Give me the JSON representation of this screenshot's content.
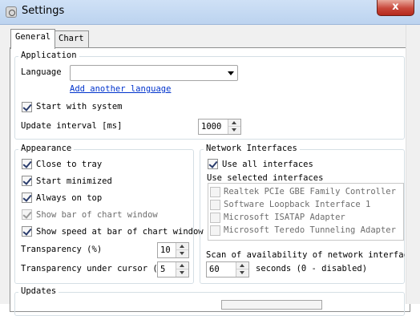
{
  "window": {
    "title": "Settings",
    "close_glyph": "x"
  },
  "tabs": [
    {
      "label": "General"
    },
    {
      "label": "Chart"
    }
  ],
  "application": {
    "title": "Application",
    "language_label": "Language",
    "language_value": "",
    "add_language_link": "Add another language",
    "start_with_system": {
      "label": "Start with system",
      "checked": true
    },
    "update_interval_label": "Update interval [ms]",
    "update_interval_value": "1000"
  },
  "appearance": {
    "title": "Appearance",
    "close_to_tray": "Close to tray",
    "start_minimized": "Start minimized",
    "always_on_top": "Always on top",
    "show_bar_chart_window": "Show bar of chart window",
    "show_speed_bar": "Show speed at bar of chart window",
    "transparency_label": "Transparency (%)",
    "transparency_value": "10",
    "transparency_cursor_label": "Transparency under cursor (%)",
    "transparency_cursor_value": "5"
  },
  "network": {
    "title": "Network Interfaces",
    "use_all_label": "Use all interfaces",
    "use_selected_label": "Use selected interfaces",
    "interfaces": [
      "Realtek PCIe GBE Family Controller",
      "Software Loopback Interface 1",
      "Microsoft ISATAP Adapter",
      "Microsoft Teredo Tunneling Adapter"
    ],
    "scan_label": "Scan of availability of network interfaces",
    "scan_value": "60",
    "scan_suffix": "seconds (0 - disabled)"
  },
  "updates": {
    "title": "Updates"
  },
  "colors": {
    "titlebar": "#cfe1f6",
    "close": "#c8473a",
    "link": "#0033cc"
  }
}
